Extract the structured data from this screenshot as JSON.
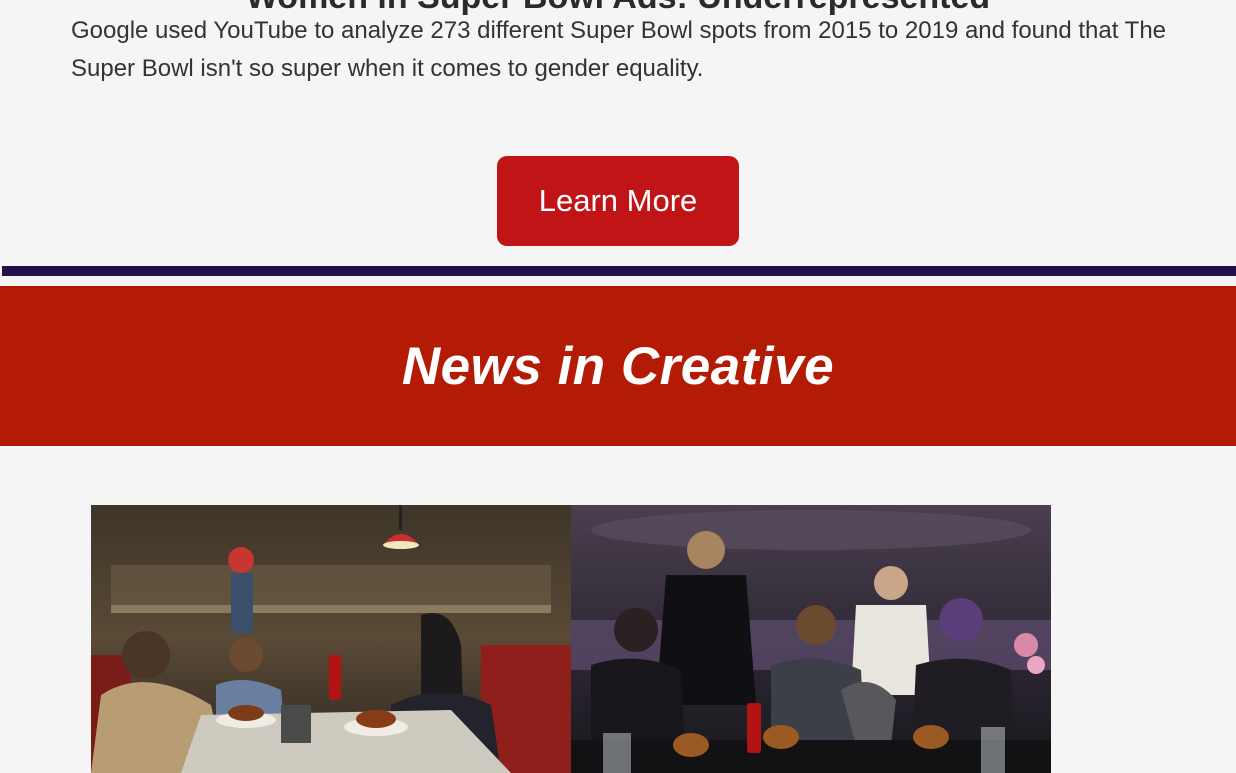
{
  "section_top": {
    "clipped_heading": "Women in Super Bowl Ads: Underrepresented",
    "body": "Google used YouTube to analyze 273 different Super Bowl spots from 2015 to 2019 and found that The Super Bowl isn't so super when it comes to gender equality.",
    "cta_label": "Learn More"
  },
  "colors": {
    "page_bg": "#f5f5f5",
    "cta_bg": "#c11416",
    "divider": "#230f4a",
    "banner_bg": "#b31b04"
  },
  "banner": {
    "title": "News in Creative"
  },
  "article_image": {
    "panels": [
      "diner-scene",
      "villain-lair-scene"
    ]
  }
}
